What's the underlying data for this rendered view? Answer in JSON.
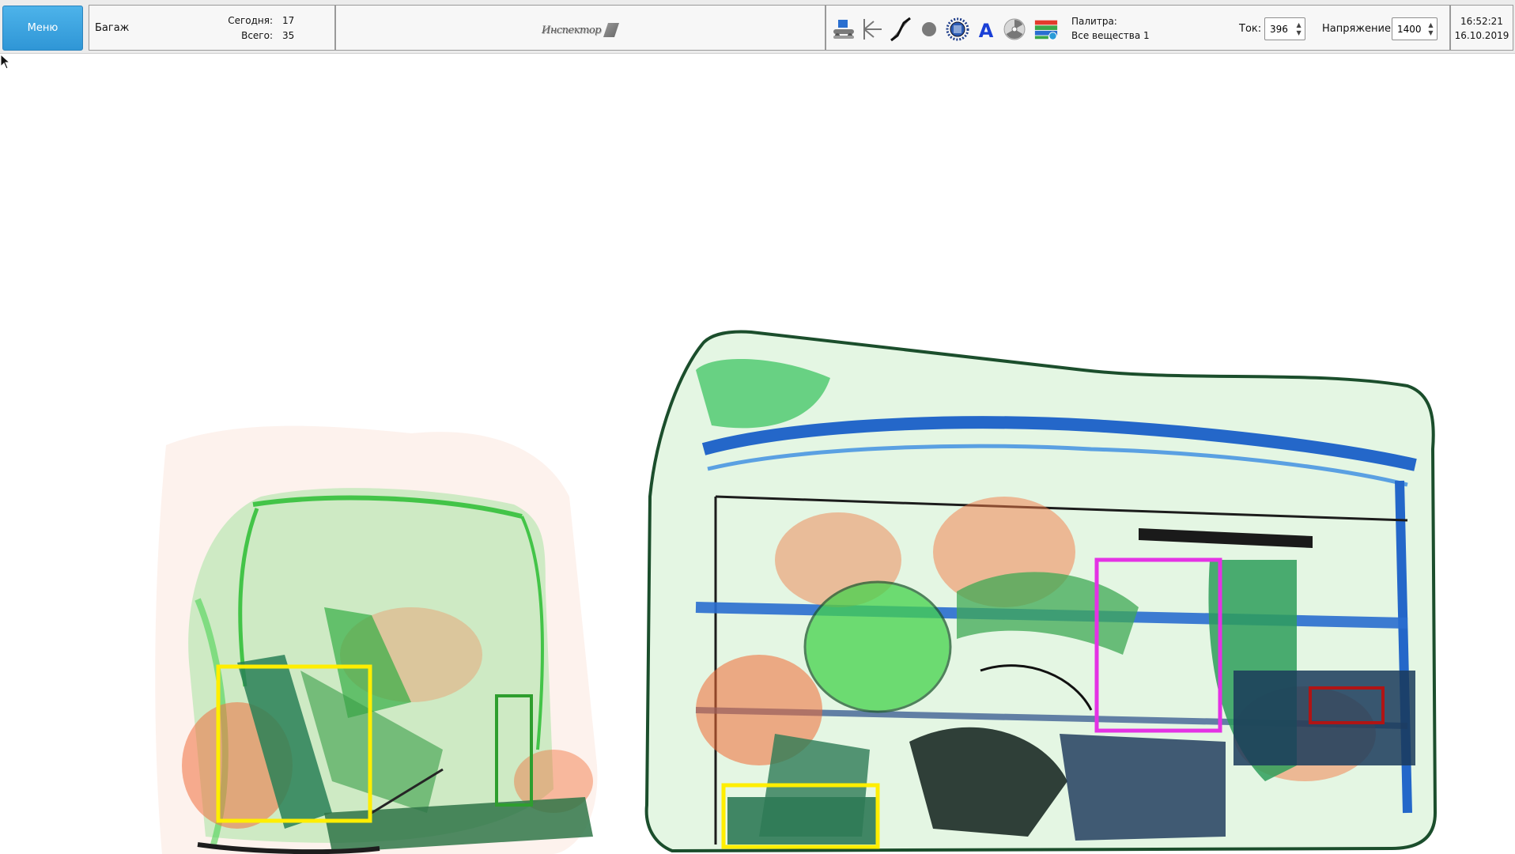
{
  "toolbar": {
    "menu_label": "Меню",
    "bag_label": "Багаж",
    "today_label": "Сегодня:",
    "today_value": "17",
    "total_label": "Всего:",
    "total_value": "35",
    "logo_text": "Инспектор",
    "palette_label": "Палитра:",
    "palette_value": "Все вещества 1",
    "current_label": "Ток:",
    "current_value": "396",
    "voltage_label": "Напряжение:",
    "voltage_value": "1400",
    "time": "16:52:21",
    "date": "16.10.2019"
  },
  "tools": [
    {
      "name": "conveyor-icon"
    },
    {
      "name": "edge-enhance-icon"
    },
    {
      "name": "contrast-curve-icon"
    },
    {
      "name": "organic-filter-icon"
    },
    {
      "name": "processor-icon"
    },
    {
      "name": "text-annotation-icon"
    },
    {
      "name": "radiation-icon"
    },
    {
      "name": "palette-icon"
    }
  ],
  "colors": {
    "menu_button": "#2f96d6",
    "frame_yellow": "#ffee00",
    "frame_magenta": "#e432e4",
    "frame_red": "#b01414",
    "frame_green": "#2e9e2e",
    "organic": "#f07a3c",
    "inorganic": "#3fcf4a",
    "metal": "#1d5fb8"
  }
}
